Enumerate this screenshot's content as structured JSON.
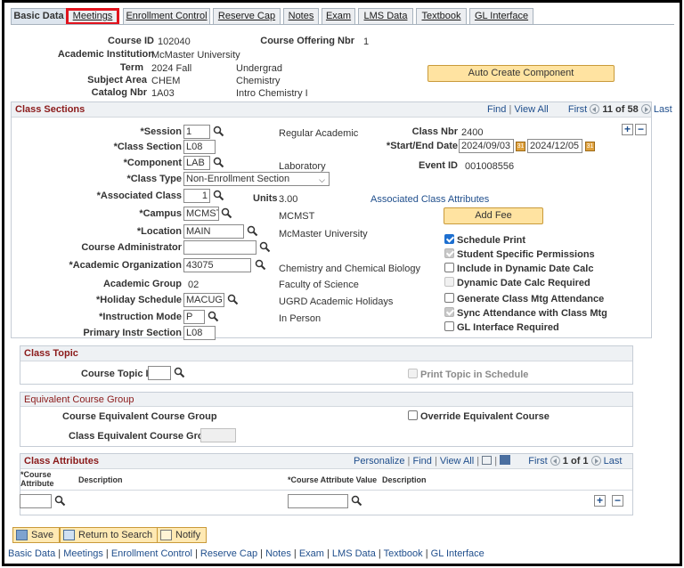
{
  "tabs": [
    "Basic Data",
    "Meetings",
    "Enrollment Control",
    "Reserve Cap",
    "Notes",
    "Exam",
    "LMS Data",
    "Textbook",
    "GL Interface"
  ],
  "header": {
    "course_id_label": "Course ID",
    "course_id": "102040",
    "offering_label": "Course Offering Nbr",
    "offering": "1",
    "institution_label": "Academic Institution",
    "institution": "McMaster University",
    "term_label": "Term",
    "term": "2024 Fall",
    "career": "Undergrad",
    "subject_label": "Subject Area",
    "subject": "CHEM",
    "subject_desc": "Chemistry",
    "catalog_label": "Catalog Nbr",
    "catalog": "1A03",
    "catalog_desc": "Intro Chemistry I",
    "auto_create": "Auto Create Component"
  },
  "class_sections": {
    "title": "Class Sections",
    "nav_find": "Find",
    "nav_sep": "|",
    "nav_viewall": "View All",
    "nav_first": "First",
    "nav_count": "11 of 58",
    "nav_last": "Last",
    "session_label": "*Session",
    "session": "1",
    "session_desc": "Regular Academic",
    "class_nbr_label": "Class Nbr",
    "class_nbr": "2400",
    "section_label": "*Class Section",
    "section": "L08",
    "dates_label": "*Start/End Date",
    "start": "2024/09/03",
    "end": "2024/12/05",
    "component_label": "*Component",
    "component": "LAB",
    "component_desc": "Laboratory",
    "event_label": "Event ID",
    "event": "001008556",
    "class_type_label": "*Class Type",
    "class_type": "Non-Enrollment Section",
    "assoc_label": "*Associated Class",
    "assoc": "1",
    "units_label": "Units",
    "units": "3.00",
    "assoc_attr_link": "Associated Class Attributes",
    "campus_label": "*Campus",
    "campus": "MCMST",
    "campus_desc": "MCMST",
    "add_fee": "Add Fee",
    "location_label": "*Location",
    "location": "MAIN",
    "location_desc": "McMaster University",
    "admin_label": "Course Administrator",
    "admin": "",
    "org_label": "*Academic Organization",
    "org": "43075",
    "org_desc": "Chemistry and Chemical Biology",
    "group_label": "Academic Group",
    "group": "02",
    "group_desc": "Faculty of Science",
    "holiday_label": "*Holiday Schedule",
    "holiday": "MACUG",
    "holiday_desc": "UGRD Academic Holidays",
    "mode_label": "*Instruction Mode",
    "mode": "P",
    "mode_desc": "In Person",
    "primary_label": "Primary Instr Section",
    "primary": "L08",
    "cb_schedule_print": "Schedule Print",
    "cb_student_perm": "Student Specific Permissions",
    "cb_dynamic": "Include in Dynamic Date Calc",
    "cb_dynamic_req": "Dynamic Date Calc Required",
    "cb_generate": "Generate Class Mtg Attendance",
    "cb_sync": "Sync Attendance with Class Mtg",
    "cb_gl": "GL Interface Required"
  },
  "class_topic": {
    "title": "Class Topic",
    "topic_label": "Course Topic ID",
    "topic": "",
    "print_topic": "Print Topic in Schedule"
  },
  "equiv": {
    "title": "Equivalent Course Group",
    "course_label": "Course Equivalent Course Group",
    "override": "Override Equivalent Course",
    "class_label": "Class Equivalent Course Group",
    "class_value": ""
  },
  "attributes": {
    "title": "Class Attributes",
    "personalize": "Personalize",
    "find": "Find",
    "viewall": "View All",
    "first": "First",
    "count": "1 of 1",
    "last": "Last",
    "col1a": "*Course",
    "col1b": "Attribute",
    "col2": "Description",
    "col3": "*Course Attribute Value",
    "col4": "Description",
    "attr": "",
    "attr_value": ""
  },
  "footer": {
    "save": "Save",
    "return": "Return to Search",
    "notify": "Notify",
    "links": [
      "Basic Data",
      "Meetings",
      "Enrollment Control",
      "Reserve Cap",
      "Notes",
      "Exam",
      "LMS Data",
      "Textbook",
      "GL Interface"
    ],
    "sep": " | "
  },
  "colors": {
    "section_title": "#8b1a1a",
    "tab_highlight": "#e1131d",
    "button": "#ffe3a1",
    "link": "#1f4e8c"
  }
}
